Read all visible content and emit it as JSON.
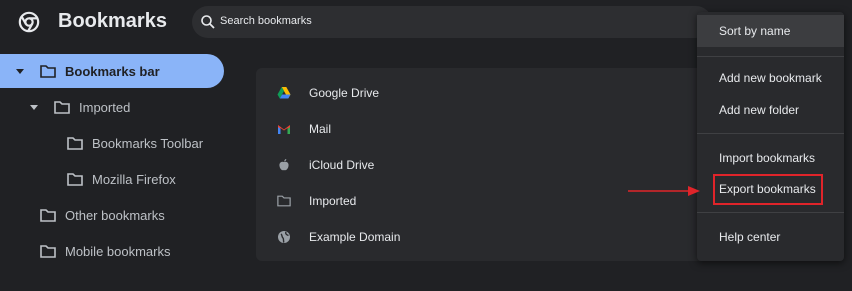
{
  "app": {
    "title": "Bookmarks"
  },
  "search": {
    "placeholder": "Search bookmarks"
  },
  "sidebar": {
    "items": [
      {
        "label": "Bookmarks bar"
      },
      {
        "label": "Imported"
      },
      {
        "label": "Bookmarks Toolbar"
      },
      {
        "label": "Mozilla Firefox"
      },
      {
        "label": "Other bookmarks"
      },
      {
        "label": "Mobile bookmarks"
      }
    ]
  },
  "bookmarks": {
    "items": [
      {
        "label": "Google Drive",
        "icon": "google-drive-icon"
      },
      {
        "label": "Mail",
        "icon": "gmail-icon"
      },
      {
        "label": "iCloud Drive",
        "icon": "apple-icon"
      },
      {
        "label": "Imported",
        "icon": "folder-icon"
      },
      {
        "label": "Example Domain",
        "icon": "globe-icon"
      }
    ]
  },
  "menu": {
    "items": [
      {
        "label": "Sort by name"
      },
      {
        "label": "Add new bookmark"
      },
      {
        "label": "Add new folder"
      },
      {
        "label": "Import bookmarks"
      },
      {
        "label": "Export bookmarks"
      },
      {
        "label": "Help center"
      }
    ]
  },
  "colors": {
    "background": "#202124",
    "selected": "#8ab4f8",
    "annotation": "#e0242a"
  }
}
